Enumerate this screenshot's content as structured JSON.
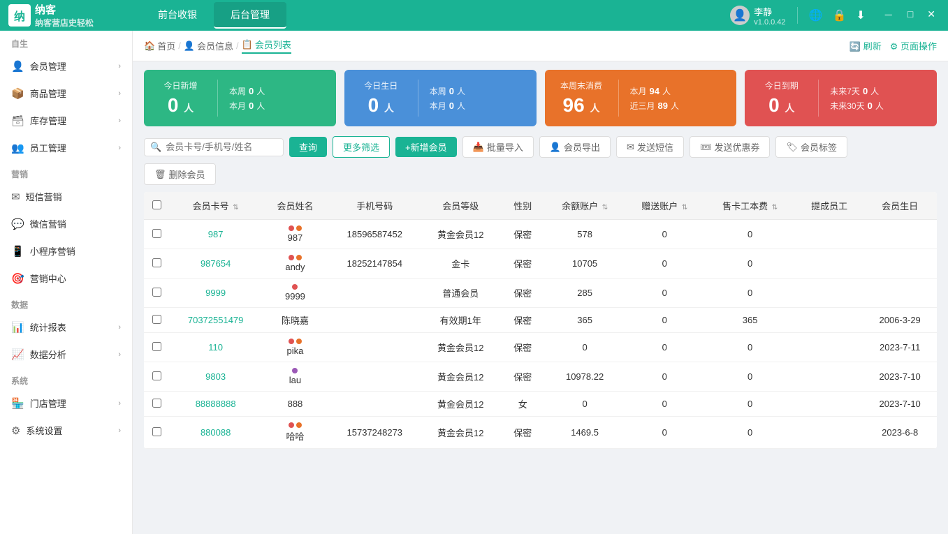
{
  "app": {
    "name": "纳客",
    "slogan": "纳客营店史轻松",
    "version": "v1.0.0.42",
    "user": "李静"
  },
  "topnav": {
    "tabs": [
      {
        "id": "frontend",
        "label": "前台收银",
        "active": false
      },
      {
        "id": "backend",
        "label": "后台管理",
        "active": true
      }
    ],
    "icons": [
      "globe",
      "lock",
      "download",
      "minimize",
      "maximize",
      "close"
    ]
  },
  "sidebar": {
    "sections": [
      {
        "title": "自生",
        "items": [
          {
            "id": "member-mgmt",
            "icon": "👤",
            "label": "会员管理",
            "hasChildren": true
          },
          {
            "id": "product-mgmt",
            "icon": "📦",
            "label": "商品管理",
            "hasChildren": true
          },
          {
            "id": "inventory-mgmt",
            "icon": "🗃",
            "label": "库存管理",
            "hasChildren": true
          },
          {
            "id": "staff-mgmt",
            "icon": "👥",
            "label": "员工管理",
            "hasChildren": true
          }
        ]
      },
      {
        "title": "营销",
        "items": [
          {
            "id": "sms-marketing",
            "icon": "✉",
            "label": "短信营销",
            "hasChildren": false
          },
          {
            "id": "wechat-marketing",
            "icon": "💬",
            "label": "微信营销",
            "hasChildren": false
          },
          {
            "id": "miniapp-marketing",
            "icon": "📱",
            "label": "小程序营销",
            "hasChildren": false
          },
          {
            "id": "marketing-center",
            "icon": "🎯",
            "label": "营销中心",
            "hasChildren": false
          }
        ]
      },
      {
        "title": "数据",
        "items": [
          {
            "id": "stats-report",
            "icon": "📊",
            "label": "统计报表",
            "hasChildren": true
          },
          {
            "id": "data-analysis",
            "icon": "📈",
            "label": "数据分析",
            "hasChildren": true
          }
        ]
      },
      {
        "title": "系统",
        "items": [
          {
            "id": "store-mgmt",
            "icon": "🏪",
            "label": "门店管理",
            "hasChildren": true
          },
          {
            "id": "system-settings",
            "icon": "⚙",
            "label": "系统设置",
            "hasChildren": true
          }
        ]
      }
    ]
  },
  "breadcrumb": {
    "items": [
      {
        "id": "home",
        "label": "首页",
        "icon": "🏠",
        "active": false
      },
      {
        "id": "member-info",
        "label": "会员信息",
        "icon": "👤",
        "active": false
      },
      {
        "id": "member-list",
        "label": "会员列表",
        "icon": "📋",
        "active": true
      }
    ],
    "actions": [
      {
        "id": "refresh",
        "label": "刷新",
        "icon": "🔄"
      },
      {
        "id": "page-ops",
        "label": "页面操作",
        "icon": "⚙"
      }
    ]
  },
  "stats": [
    {
      "id": "new-today",
      "color": "green",
      "label": "今日新增",
      "value": "0",
      "unit": "人",
      "side": [
        {
          "label": "本周",
          "value": "0",
          "unit": "人"
        },
        {
          "label": "本月",
          "value": "0",
          "unit": "人"
        }
      ]
    },
    {
      "id": "birthday-today",
      "color": "blue",
      "label": "今日生日",
      "value": "0",
      "unit": "人",
      "side": [
        {
          "label": "本周",
          "value": "0",
          "unit": "人"
        },
        {
          "label": "本月",
          "value": "0",
          "unit": "人"
        }
      ]
    },
    {
      "id": "no-consume-week",
      "color": "orange",
      "label": "本周末消费",
      "value": "96",
      "unit": "人",
      "side": [
        {
          "label": "本月",
          "value": "94",
          "unit": "人"
        },
        {
          "label": "近三月",
          "value": "89",
          "unit": "人"
        }
      ]
    },
    {
      "id": "expire-today",
      "color": "red",
      "label": "今日到期",
      "value": "0",
      "unit": "人",
      "side": [
        {
          "label": "未来7天",
          "value": "0",
          "unit": "人"
        },
        {
          "label": "未来30天",
          "value": "0",
          "unit": "人"
        }
      ]
    }
  ],
  "toolbar": {
    "search_placeholder": "会员卡号/手机号/姓名",
    "query_label": "查询",
    "more_filter_label": "更多筛选",
    "add_member_label": "+新增会员",
    "batch_import_label": "批量导入",
    "member_export_label": "会员导出",
    "send_sms_label": "发送短信",
    "send_coupon_label": "发送优惠券",
    "member_tag_label": "会员标签",
    "delete_member_label": "删除会员"
  },
  "table": {
    "columns": [
      {
        "id": "checkbox",
        "label": ""
      },
      {
        "id": "card-no",
        "label": "会员卡号",
        "sortable": true
      },
      {
        "id": "name",
        "label": "会员姓名"
      },
      {
        "id": "phone",
        "label": "手机号码"
      },
      {
        "id": "level",
        "label": "会员等级"
      },
      {
        "id": "gender",
        "label": "性别"
      },
      {
        "id": "balance",
        "label": "余额账户",
        "sortable": true
      },
      {
        "id": "gift",
        "label": "赠送账户",
        "sortable": true
      },
      {
        "id": "sell-cost",
        "label": "售卡工本费",
        "sortable": true
      },
      {
        "id": "referrer",
        "label": "提成员工"
      },
      {
        "id": "birthday",
        "label": "会员生日"
      }
    ],
    "rows": [
      {
        "card_no": "987",
        "name": "987",
        "dots": [
          "red",
          "orange"
        ],
        "phone": "18596587452",
        "level": "黄金会员12",
        "gender": "保密",
        "balance": "578",
        "gift": "0",
        "sell_cost": "0",
        "referrer": "",
        "birthday": ""
      },
      {
        "card_no": "987654",
        "name": "andy",
        "dots": [
          "red",
          "orange"
        ],
        "phone": "18252147854",
        "level": "金卡",
        "gender": "保密",
        "balance": "10705",
        "gift": "0",
        "sell_cost": "0",
        "referrer": "",
        "birthday": ""
      },
      {
        "card_no": "9999",
        "name": "9999",
        "dots": [
          "red"
        ],
        "phone": "",
        "level": "普通会员",
        "gender": "保密",
        "balance": "285",
        "gift": "0",
        "sell_cost": "0",
        "referrer": "",
        "birthday": ""
      },
      {
        "card_no": "70372551479",
        "name": "陈晓嘉",
        "dots": [],
        "phone": "",
        "level": "有效期1年",
        "gender": "保密",
        "balance": "365",
        "gift": "0",
        "sell_cost": "365",
        "referrer": "",
        "birthday": "2006-3-29"
      },
      {
        "card_no": "110",
        "name": "pika",
        "dots": [
          "red",
          "orange"
        ],
        "phone": "",
        "level": "黄金会员12",
        "gender": "保密",
        "balance": "0",
        "gift": "0",
        "sell_cost": "0",
        "referrer": "",
        "birthday": "2023-7-11"
      },
      {
        "card_no": "9803",
        "name": "lau",
        "dots": [
          "purple"
        ],
        "phone": "",
        "level": "黄金会员12",
        "gender": "保密",
        "balance": "10978.22",
        "gift": "0",
        "sell_cost": "0",
        "referrer": "",
        "birthday": "2023-7-10"
      },
      {
        "card_no": "88888888",
        "name": "888",
        "dots": [],
        "phone": "",
        "level": "黄金会员12",
        "gender": "女",
        "balance": "0",
        "gift": "0",
        "sell_cost": "0",
        "referrer": "",
        "birthday": "2023-7-10"
      },
      {
        "card_no": "880088",
        "name": "哈哈",
        "dots": [
          "red",
          "orange"
        ],
        "phone": "15737248273",
        "level": "黄金会员12",
        "gender": "保密",
        "balance": "1469.5",
        "gift": "0",
        "sell_cost": "0",
        "referrer": "",
        "birthday": "2023-6-8"
      }
    ]
  }
}
